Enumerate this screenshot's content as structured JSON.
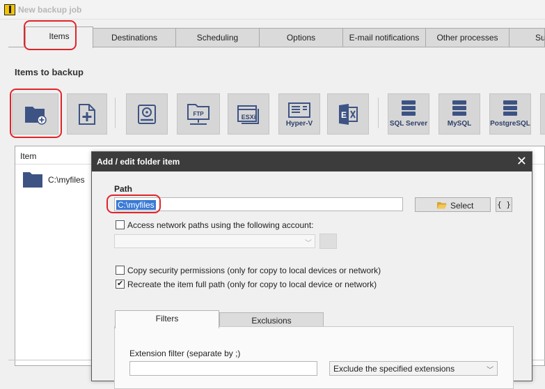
{
  "window": {
    "title": "New backup job"
  },
  "tabs": [
    "Items",
    "Destinations",
    "Scheduling",
    "Options",
    "E-mail notifications",
    "Other processes",
    "Su"
  ],
  "items_section": {
    "title": "Items to backup",
    "toolbar": [
      {
        "name": "add-folder",
        "icon": "folder-add-icon",
        "label": ""
      },
      {
        "name": "add-file",
        "icon": "file-add-icon",
        "label": ""
      },
      {
        "name": "disk-image",
        "icon": "hard-disk-icon",
        "label": ""
      },
      {
        "name": "ftp",
        "icon": "ftp-folder-icon",
        "label": "FTP"
      },
      {
        "name": "esxi",
        "icon": "esxi-icon",
        "label": "ESXi"
      },
      {
        "name": "hyper-v",
        "icon": "hyper-v-icon",
        "label": "Hyper-V"
      },
      {
        "name": "exchange",
        "icon": "exchange-icon",
        "label": ""
      },
      {
        "name": "sql-server",
        "icon": "database-icon",
        "label": "SQL Server"
      },
      {
        "name": "mysql",
        "icon": "database-icon",
        "label": "MySQL"
      },
      {
        "name": "postgresql",
        "icon": "database-icon",
        "label": "PostgreSQL"
      }
    ],
    "list": {
      "column_item": "Item",
      "rows": [
        {
          "icon": "folder-icon",
          "text": "C:\\myfiles"
        }
      ]
    }
  },
  "dialog": {
    "title": "Add / edit folder item",
    "close_glyph": "✕",
    "path_label": "Path",
    "path_value": "C:\\myfiles",
    "select_button": "Select",
    "braces_button": "{ }",
    "network_checkbox": {
      "label": "Access network paths using the following account:",
      "checked": false
    },
    "copy_security": {
      "label": "Copy security permissions (only for copy to local devices or network)",
      "checked": false
    },
    "recreate_path": {
      "label": "Recreate the item full path (only for copy to local device or network)",
      "checked": true
    },
    "subtabs": [
      "Filters",
      "Exclusions"
    ],
    "extension_filter_label": "Extension filter (separate by ;)",
    "extension_mode": "Exclude the specified extensions"
  },
  "colors": {
    "highlight": "#e0242a",
    "icon_blue": "#3d5383",
    "selection": "#3a7ad6",
    "dialog_title_bg": "#3c3c3c"
  }
}
